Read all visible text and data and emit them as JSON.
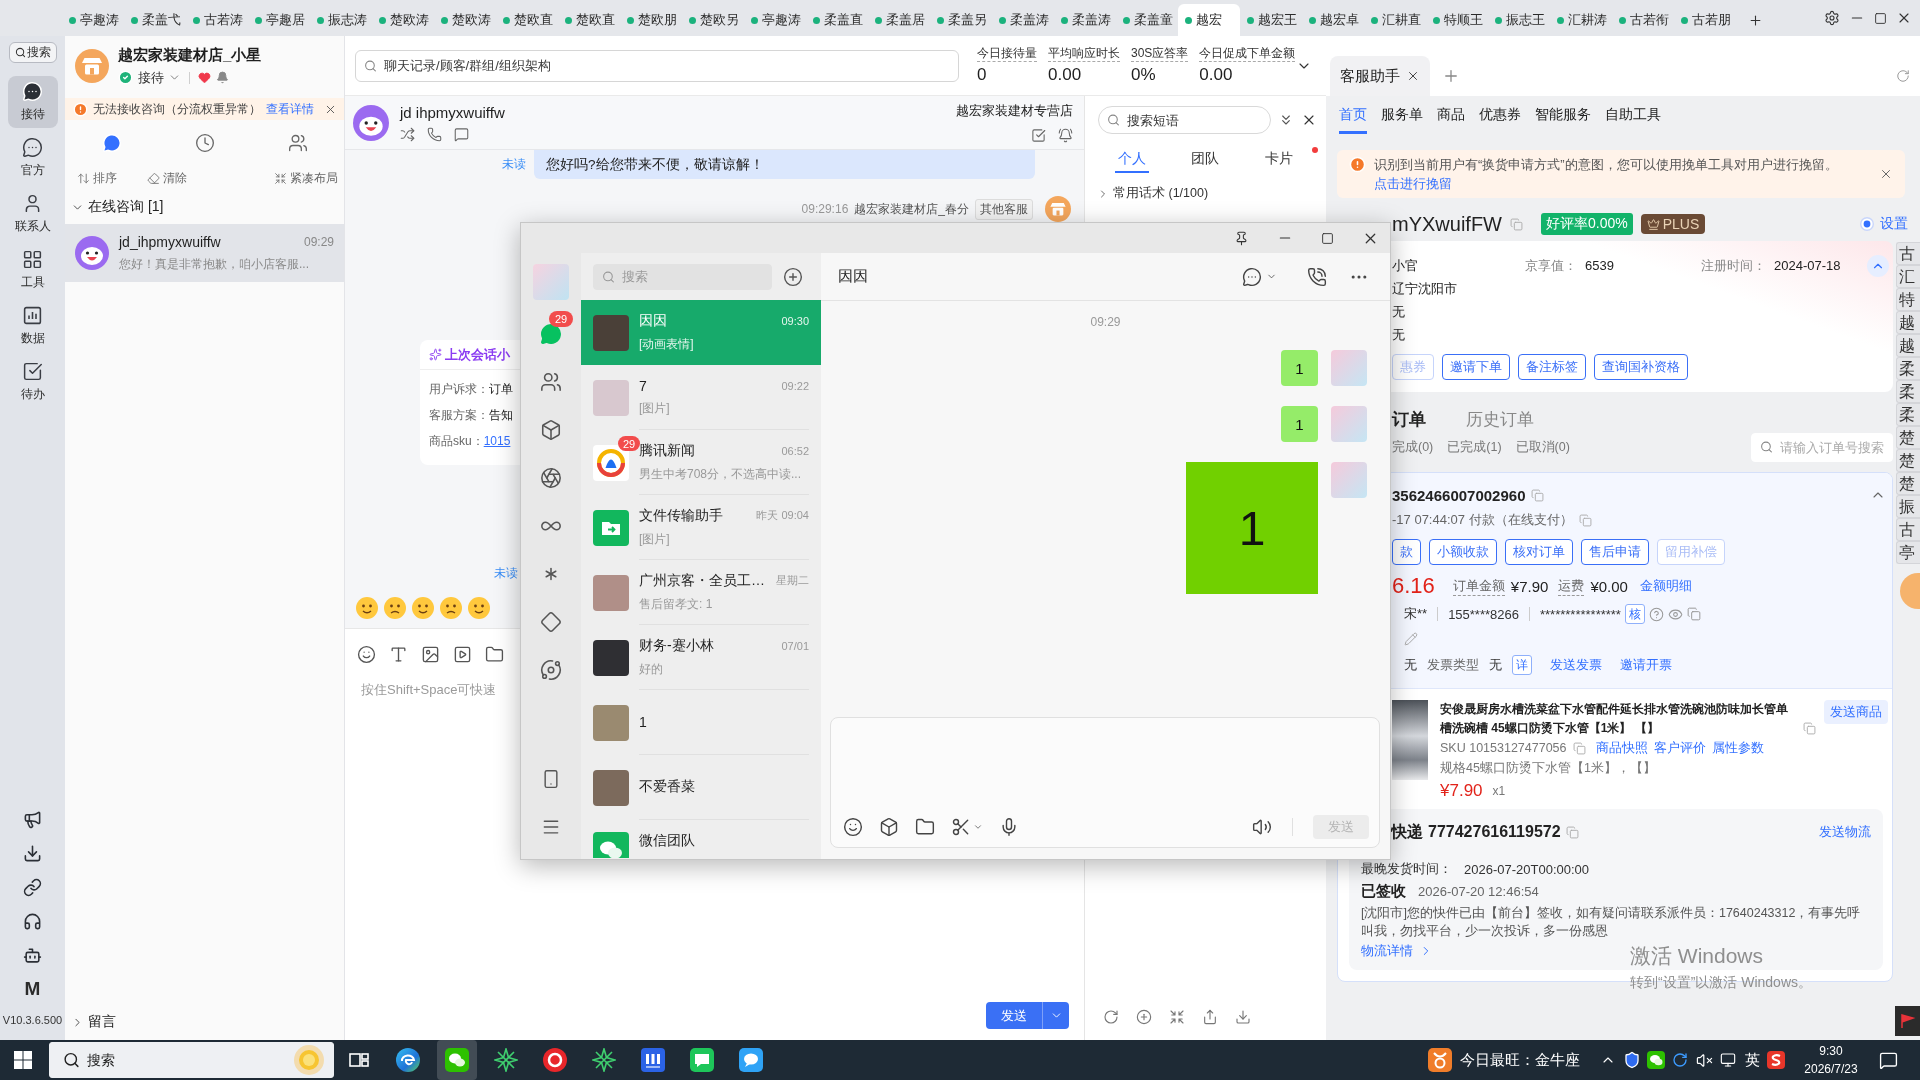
{
  "top_bar": {
    "tabs": [
      {
        "label": "亭趣涛",
        "selected": false
      },
      {
        "label": "柔盖弋",
        "selected": false
      },
      {
        "label": "古若涛",
        "selected": false
      },
      {
        "label": "亭趣居",
        "selected": false
      },
      {
        "label": "振志涛",
        "selected": false
      },
      {
        "label": "楚欧涛",
        "selected": false
      },
      {
        "label": "楚欧涛",
        "selected": false
      },
      {
        "label": "楚欧直",
        "selected": false
      },
      {
        "label": "楚欧直",
        "selected": false
      },
      {
        "label": "楚欧朋",
        "selected": false
      },
      {
        "label": "楚欧另",
        "selected": false
      },
      {
        "label": "亭趣涛",
        "selected": false
      },
      {
        "label": "柔盖直",
        "selected": false
      },
      {
        "label": "柔盖居",
        "selected": false
      },
      {
        "label": "柔盖另",
        "selected": false
      },
      {
        "label": "柔盖涛",
        "selected": false
      },
      {
        "label": "柔盖涛",
        "selected": false
      },
      {
        "label": "柔盖童",
        "selected": false
      },
      {
        "label": "越宏",
        "selected": true
      },
      {
        "label": "越宏王",
        "selected": false
      },
      {
        "label": "越宏卓",
        "selected": false
      },
      {
        "label": "汇耕直",
        "selected": false
      },
      {
        "label": "特顺王",
        "selected": false
      },
      {
        "label": "振志王",
        "selected": false
      },
      {
        "label": "汇耕涛",
        "selected": false
      },
      {
        "label": "古若衔",
        "selected": false
      },
      {
        "label": "古若朋",
        "selected": false
      }
    ]
  },
  "nav": {
    "search": "搜索",
    "items": [
      {
        "label": "接待",
        "selected": true
      },
      {
        "label": "官方",
        "selected": false
      },
      {
        "label": "联系人",
        "selected": false
      },
      {
        "label": "工具",
        "selected": false
      },
      {
        "label": "数据",
        "selected": false
      },
      {
        "label": "待办",
        "selected": false
      }
    ],
    "logo": "M",
    "version": "V10.3.6.500"
  },
  "session_panel": {
    "shop_name": "越宏家装建材店_小星",
    "status": "接待",
    "warning": {
      "text": "无法接收咨询（分流权重异常）",
      "link": "查看详情"
    },
    "views": [
      {
        "selected": true
      },
      {
        "selected": false
      },
      {
        "selected": false
      }
    ],
    "actions": [
      "排序",
      "清除",
      "紧凑布局"
    ],
    "online_group": {
      "title": "在线咨询 [1]",
      "expanded": true,
      "sessions": [
        {
          "name": "jd_ihpmyxwuiffw",
          "time": "09:29",
          "preview": "您好！真是非常抱歉，咱小店客服...",
          "selected": true
        }
      ]
    },
    "message_group": {
      "title": "留言",
      "expanded": false
    }
  },
  "workspace": {
    "search": {
      "placeholder": "聊天记录/顾客/群组/组织架构"
    },
    "stats": [
      {
        "label": "今日接待量",
        "value": "0"
      },
      {
        "label": "平均响应时长",
        "value": "0.00"
      },
      {
        "label": "30S应答率",
        "value": "0%"
      },
      {
        "label": "今日促成下单金额",
        "value": "0.00"
      }
    ]
  },
  "chat": {
    "customer": "jd ihpmyxwuiffw",
    "shop": "越宏家装建材专营店",
    "message": {
      "status": "未读",
      "text": "您好吗?给您带来不便，敬请谅解！"
    },
    "sender": {
      "time": "09:29:16",
      "name": "越宏家装建材店_春分",
      "tag": "其他客服"
    },
    "summary": {
      "title": "上次会话小",
      "rows": [
        {
          "label": "用户诉求：",
          "value": "订单",
          "link": false
        },
        {
          "label": "客服方案：",
          "value": "告知",
          "link": false
        },
        {
          "label": "商品sku：",
          "value": "1015",
          "link": true
        }
      ]
    },
    "status_mark": "未读",
    "input": {
      "placeholder": "按住Shift+Space可快速"
    },
    "send": "发送"
  },
  "phrases": {
    "search": {
      "placeholder": "搜索短语"
    },
    "tabs": [
      {
        "label": "个人",
        "selected": true,
        "dot": false
      },
      {
        "label": "团队",
        "selected": false,
        "dot": false
      },
      {
        "label": "卡片",
        "selected": false,
        "dot": true
      }
    ],
    "group": {
      "title": "常用话术 (1/100)",
      "expanded": false
    }
  },
  "assistant": {
    "tab": "客服助手",
    "nav": [
      {
        "label": "首页",
        "selected": true
      },
      {
        "label": "服务单",
        "selected": false
      },
      {
        "label": "商品",
        "selected": false
      },
      {
        "label": "优惠券",
        "selected": false
      },
      {
        "label": "智能服务",
        "selected": false
      },
      {
        "label": "自助工具",
        "selected": false
      }
    ],
    "alert": {
      "text": "识别到当前用户有“换货申请方式”的意图，您可以使用挽单工具对用户进行挽留。",
      "link": "点击进行挽留"
    },
    "customer": {
      "name": "mYXwuifFW",
      "rating": "好评率0.00%",
      "member": "PLUS",
      "setting": {
        "label": "设置",
        "on": true
      }
    },
    "profile": {
      "name": "小官",
      "score_label": "京享值：",
      "score": "6539",
      "registered_label": "注册时间：",
      "registered": "2024-07-18",
      "rows": [
        "辽宁沈阳市",
        "无",
        "无"
      ],
      "expanded": true,
      "actions": [
        {
          "label": "惠券",
          "disabled": true
        },
        {
          "label": "邀请下单",
          "disabled": false
        },
        {
          "label": "备注标签",
          "disabled": false
        },
        {
          "label": "查询国补资格",
          "disabled": false
        }
      ]
    },
    "order_tabs": [
      {
        "label": "订单",
        "selected": true
      },
      {
        "label": "历史订单",
        "selected": false
      }
    ],
    "order_filters": [
      "完成(0)",
      "已完成(1)",
      "已取消(0)"
    ],
    "order_search": {
      "placeholder": "请输入订单号搜索"
    },
    "order": {
      "number": "3562466007002960",
      "expanded": true,
      "paid": "-17 07:44:07 付款（在线支付）",
      "actions": [
        {
          "label": "款",
          "disabled": false
        },
        {
          "label": "小额收款",
          "disabled": false
        },
        {
          "label": "核对订单",
          "disabled": false
        },
        {
          "label": "售后申请",
          "disabled": false
        },
        {
          "label": "留用补偿",
          "disabled": true
        }
      ],
      "paid_amount": "6.16",
      "amount_label": "订单金额",
      "amount": "¥7.90",
      "freight_label": "运费",
      "freight": "¥0.00",
      "amount_link": "金额明细",
      "receiver": "宋**",
      "phone": "155****8266",
      "address": "****************",
      "verify": "核",
      "invoice": "无",
      "invoice_type_label": "发票类型",
      "invoice_type": "无",
      "invoice_detail": "详",
      "invoice_links": [
        "发送发票",
        "邀请开票"
      ],
      "product": {
        "title": "安俊晟厨房水槽洗菜盆下水管配件延长排水管洗碗池防味加长管单槽洗碗槽 45螺口防烫下水管【1米】 【】",
        "send": "发送商品",
        "sku": "SKU 10153127477056",
        "links": [
          "商品快照",
          "客户评价",
          "属性参数"
        ],
        "spec": "规格45螺口防烫下水管【1米】，【】",
        "price": "¥7.90",
        "quantity": "x1"
      },
      "shipping": {
        "carrier": "快递",
        "tracking": "777427616119572",
        "send": "发送物流",
        "deadline_label": "最晚发货时间：",
        "deadline": "2026-07-20T00:00:00",
        "status": "已签收",
        "time": "2026-07-20 12:46:54",
        "detail": "[沈阳市]您的快件已由【前台】签收，如有疑问请联系派件员：17640243312，有事先呼叫我，勿找平台，少一次投诉，多一份感恩",
        "more": "物流详情"
      }
    }
  },
  "edge_tabs": [
    "古",
    "汇",
    "特",
    "越",
    "越",
    "柔",
    "柔",
    "柔",
    "楚",
    "楚",
    "楚",
    "振",
    "古",
    "亭"
  ],
  "wechat": {
    "rail": [
      {
        "selected": true,
        "badge": "29"
      },
      {
        "selected": false
      },
      {
        "selected": false
      },
      {
        "selected": false
      },
      {
        "selected": false
      },
      {
        "selected": false
      },
      {
        "selected": false
      },
      {
        "selected": false
      }
    ],
    "search": {
      "placeholder": "搜索"
    },
    "chats": [
      {
        "name": "因因",
        "time": "09:30",
        "preview": "[动画表情]",
        "kind": "photo",
        "selected": true
      },
      {
        "name": "7",
        "time": "09:22",
        "preview": "[图片]",
        "kind": "photo",
        "selected": false
      },
      {
        "name": "腾讯新闻",
        "time": "06:52",
        "preview": "男生中考708分，不选高中读...",
        "kind": "news",
        "badge": "29",
        "selected": false
      },
      {
        "name": "文件传输助手",
        "time": "昨天 09:04",
        "preview": "[图片]",
        "kind": "file",
        "selected": false
      },
      {
        "name": "广州京客・全员工…",
        "time": "星期二",
        "preview": "售后留孝文: 1",
        "kind": "photo",
        "selected": false
      },
      {
        "name": "财务-蹇小林",
        "time": "07/01",
        "preview": "好的",
        "kind": "photo",
        "selected": false
      },
      {
        "name": "1",
        "kind": "photo",
        "selected": false
      },
      {
        "name": "不爱香菜",
        "kind": "photo",
        "selected": false
      },
      {
        "name": "微信团队",
        "kind": "wechat",
        "selected": false
      }
    ],
    "conversation": {
      "title": "因因",
      "time": "09:29",
      "messages": [
        {
          "kind": "text",
          "text": "1"
        },
        {
          "kind": "text",
          "text": "1"
        },
        {
          "kind": "sticker",
          "text": "1"
        }
      ],
      "send": {
        "label": "发送",
        "disabled": true
      }
    }
  },
  "activation": {
    "title": "激活 Windows",
    "hint": "转到“设置”以激活 Windows。"
  },
  "taskbar": {
    "search": {
      "placeholder": "搜索"
    },
    "apps": [
      {
        "kind": "task-view",
        "active": false
      },
      {
        "kind": "edge",
        "active": false
      },
      {
        "kind": "wechat",
        "active": true
      },
      {
        "kind": "star",
        "active": false
      },
      {
        "kind": "record",
        "active": false
      },
      {
        "kind": "star",
        "active": false
      },
      {
        "kind": "m",
        "active": false
      },
      {
        "kind": "chat",
        "active": false
      },
      {
        "kind": "bubble",
        "active": false
      }
    ],
    "horoscope": "今日最旺：金牛座",
    "ime": "英",
    "time": "9:30",
    "date": "2026/7/23"
  }
}
